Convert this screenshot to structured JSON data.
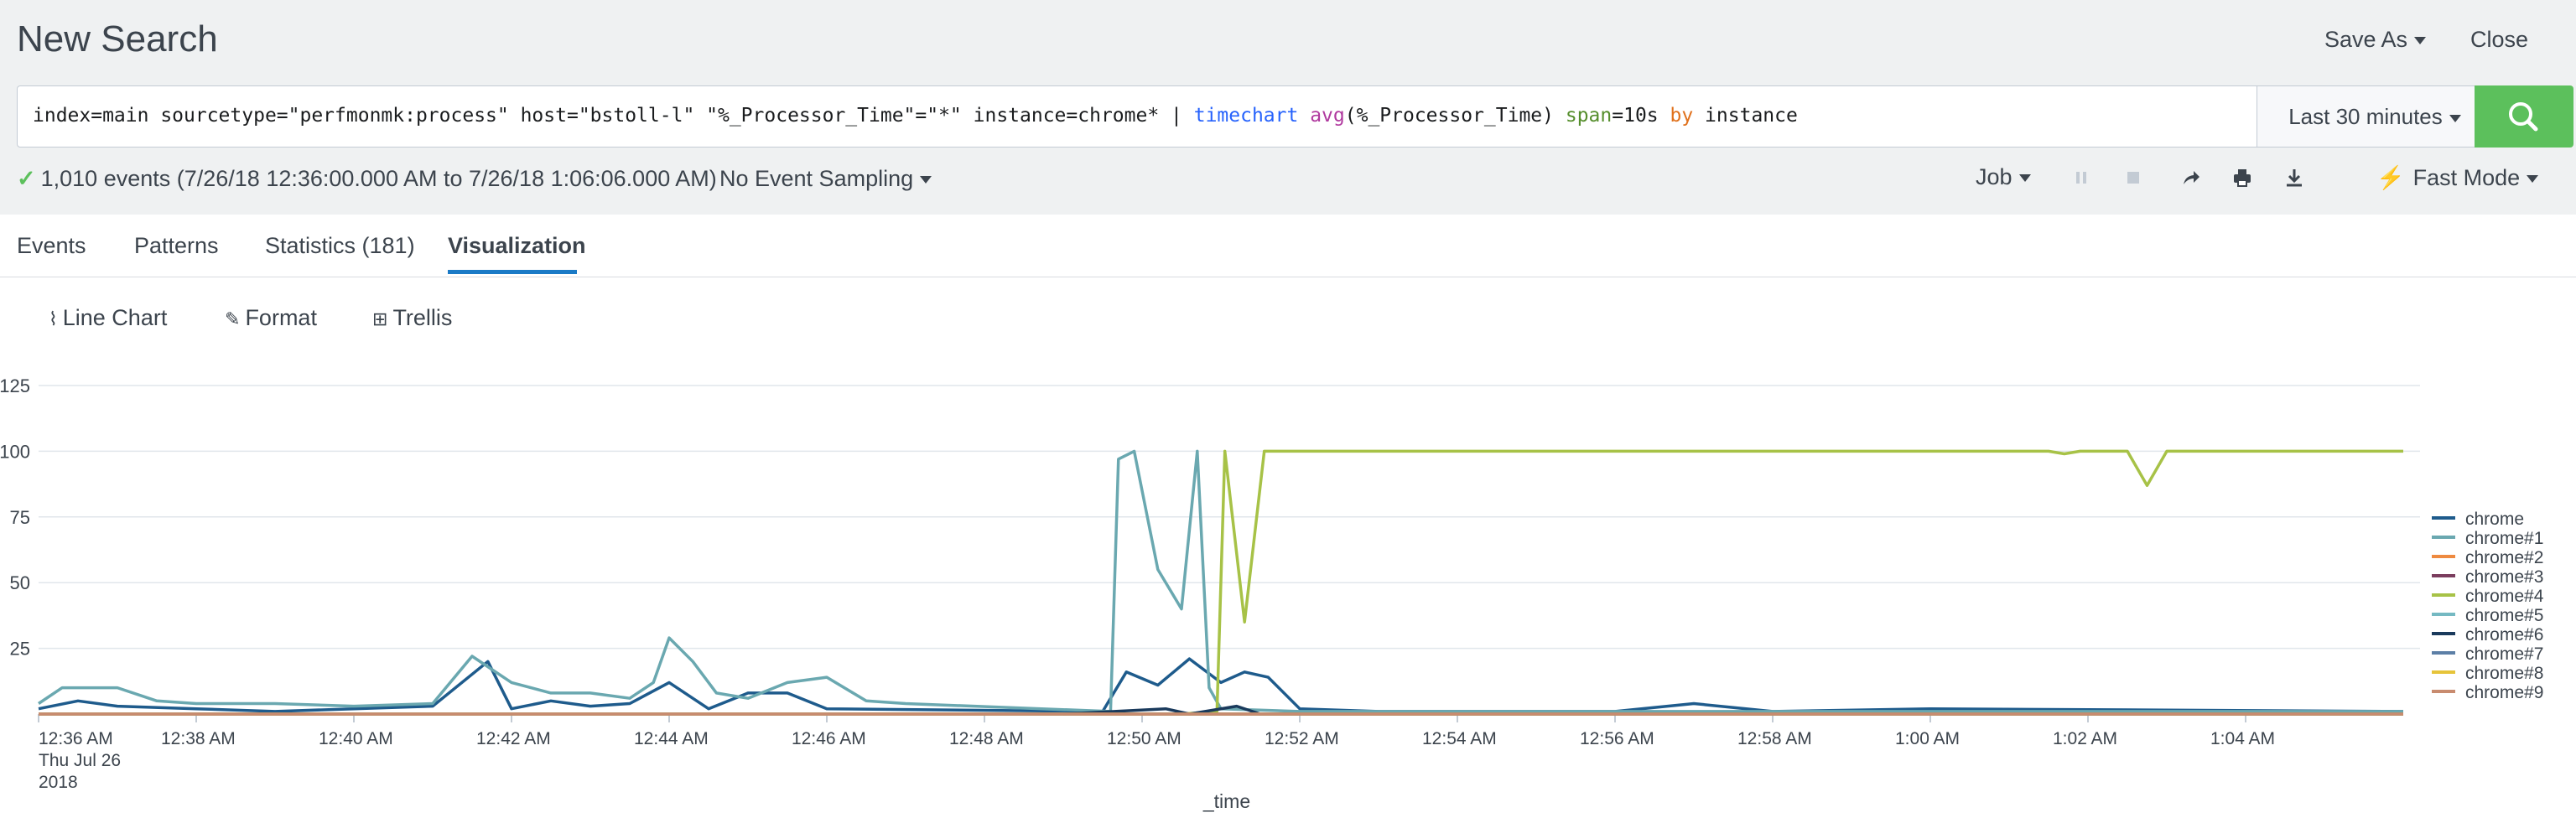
{
  "header": {
    "title": "New Search",
    "save_as": "Save As",
    "close": "Close"
  },
  "search": {
    "query_parts": {
      "p1": "index=main sourcetype=\"perfmonmk:process\" host=\"bstoll-l\" \"%_Processor_Time\"=\"*\" instance=chrome* | ",
      "cmd": "timechart",
      "sp1": " ",
      "fn": "avg",
      "p2": "(%_Processor_Time) ",
      "arg": "span",
      "p3": "=10s ",
      "kw": "by",
      "p4": " instance"
    },
    "time_range": "Last 30 minutes"
  },
  "status": {
    "events_text": "1,010 events (7/26/18 12:36:00.000 AM to 7/26/18 1:06:06.000 AM)",
    "sampling": "No Event Sampling",
    "job": "Job",
    "mode": "Fast Mode"
  },
  "tabs": [
    {
      "label": "Events"
    },
    {
      "label": "Patterns"
    },
    {
      "label": "Statistics (181)"
    },
    {
      "label": "Visualization"
    }
  ],
  "viz_tools": {
    "line_chart": "Line Chart",
    "format": "Format",
    "trellis": "Trellis"
  },
  "icons": {
    "check": "check-icon",
    "search": "search-icon",
    "pause": "pause-icon",
    "stop": "stop-icon",
    "share": "share-icon",
    "print": "print-icon",
    "export": "download-icon",
    "bolt": "bolt-icon"
  },
  "colors": {
    "accent": "#1a7ac6",
    "search_button": "#5cc05c"
  },
  "chart_data": {
    "type": "line",
    "xlabel": "_time",
    "ylim": [
      0,
      125
    ],
    "yticks": [
      25,
      50,
      75,
      100,
      125
    ],
    "xtick_labels": [
      "12:36 AM",
      "12:38 AM",
      "12:40 AM",
      "12:42 AM",
      "12:44 AM",
      "12:46 AM",
      "12:48 AM",
      "12:50 AM",
      "12:52 AM",
      "12:54 AM",
      "12:56 AM",
      "12:58 AM",
      "1:00 AM",
      "1:02 AM",
      "1:04 AM"
    ],
    "x_date_label": [
      "Thu Jul 26",
      "2018"
    ],
    "x_range_minutes": [
      0,
      30
    ],
    "legend_position": "right",
    "series": [
      {
        "name": "chrome",
        "color": "#1e5b8c",
        "points": [
          [
            0,
            2
          ],
          [
            0.5,
            5
          ],
          [
            1,
            3
          ],
          [
            2,
            2
          ],
          [
            3,
            1
          ],
          [
            4,
            2
          ],
          [
            5,
            3
          ],
          [
            5.7,
            20
          ],
          [
            6,
            2
          ],
          [
            6.5,
            5
          ],
          [
            7,
            3
          ],
          [
            7.5,
            4
          ],
          [
            8,
            12
          ],
          [
            8.5,
            2
          ],
          [
            9,
            8
          ],
          [
            9.5,
            8
          ],
          [
            10,
            2
          ],
          [
            13.5,
            1
          ],
          [
            13.8,
            16
          ],
          [
            14.2,
            11
          ],
          [
            14.6,
            21
          ],
          [
            15,
            12
          ],
          [
            15.3,
            16
          ],
          [
            15.6,
            14
          ],
          [
            16,
            2
          ],
          [
            17,
            1
          ],
          [
            20,
            1
          ],
          [
            21,
            4
          ],
          [
            22,
            1
          ],
          [
            24,
            2
          ],
          [
            30,
            1
          ]
        ]
      },
      {
        "name": "chrome#1",
        "color": "#6aa8b0",
        "points": [
          [
            0,
            4
          ],
          [
            0.3,
            10
          ],
          [
            1,
            10
          ],
          [
            1.5,
            5
          ],
          [
            2,
            4
          ],
          [
            3,
            4
          ],
          [
            4,
            3
          ],
          [
            5,
            4
          ],
          [
            5.5,
            22
          ],
          [
            6,
            12
          ],
          [
            6.5,
            8
          ],
          [
            7,
            8
          ],
          [
            7.5,
            6
          ],
          [
            7.8,
            12
          ],
          [
            8,
            29
          ],
          [
            8.3,
            20
          ],
          [
            8.6,
            8
          ],
          [
            9,
            6
          ],
          [
            9.5,
            12
          ],
          [
            10,
            14
          ],
          [
            10.5,
            5
          ],
          [
            11,
            4
          ],
          [
            13.6,
            1
          ],
          [
            13.7,
            97
          ],
          [
            13.9,
            100
          ],
          [
            14.2,
            55
          ],
          [
            14.5,
            40
          ],
          [
            14.7,
            100
          ],
          [
            14.85,
            10
          ],
          [
            15,
            2
          ],
          [
            16,
            1
          ],
          [
            30,
            1
          ]
        ]
      },
      {
        "name": "chrome#2",
        "color": "#ee8a40",
        "points": [
          [
            0,
            0
          ],
          [
            30,
            0
          ]
        ]
      },
      {
        "name": "chrome#3",
        "color": "#7b3d5e",
        "points": [
          [
            0,
            0
          ],
          [
            30,
            0
          ]
        ]
      },
      {
        "name": "chrome#4",
        "color": "#a7c247",
        "points": [
          [
            14.5,
            0
          ],
          [
            14.95,
            1
          ],
          [
            15.05,
            100
          ],
          [
            15.3,
            35
          ],
          [
            15.55,
            100
          ],
          [
            25.5,
            100
          ],
          [
            25.7,
            99
          ],
          [
            25.9,
            100
          ],
          [
            26.5,
            100
          ],
          [
            26.75,
            87
          ],
          [
            27,
            100
          ],
          [
            30,
            100
          ]
        ]
      },
      {
        "name": "chrome#5",
        "color": "#75b9c2",
        "points": [
          [
            0,
            0
          ],
          [
            30,
            0
          ]
        ]
      },
      {
        "name": "chrome#6",
        "color": "#1a3a5c",
        "points": [
          [
            13,
            0
          ],
          [
            14.3,
            2
          ],
          [
            14.6,
            0
          ],
          [
            15.2,
            3
          ],
          [
            15.5,
            0
          ],
          [
            30,
            0
          ]
        ]
      },
      {
        "name": "chrome#7",
        "color": "#5c7fa6",
        "points": [
          [
            0,
            0
          ],
          [
            30,
            0
          ]
        ]
      },
      {
        "name": "chrome#8",
        "color": "#e6c43a",
        "points": [
          [
            0,
            0
          ],
          [
            30,
            0
          ]
        ]
      },
      {
        "name": "chrome#9",
        "color": "#c88b6f",
        "points": [
          [
            0,
            0
          ],
          [
            30,
            0
          ]
        ]
      }
    ]
  }
}
